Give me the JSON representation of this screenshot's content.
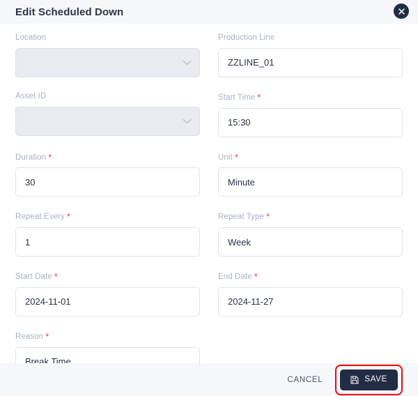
{
  "dialog": {
    "title": "Edit Scheduled Down",
    "close_icon": "close-icon"
  },
  "colors": {
    "header_bg": "#f6f7fb",
    "footer_bg": "#f6f7fb",
    "accent_dark": "#232c45",
    "required_asterisk": "#f0395a",
    "label": "#a9b1c4",
    "border": "#dfe3ec",
    "disabled_bg": "#e9ebf0",
    "highlight_outline": "#ff0000"
  },
  "form": {
    "fields": [
      {
        "name": "location",
        "label": "Location",
        "required": false,
        "type": "select",
        "value": "",
        "placeholder": "",
        "disabled": true,
        "icon": "chevron-down-icon"
      },
      {
        "name": "production-line",
        "label": "Production Line",
        "required": false,
        "type": "text",
        "value": "ZZLINE_01",
        "placeholder": "",
        "disabled": false
      },
      {
        "name": "asset-id",
        "label": "Asset ID",
        "required": false,
        "type": "select",
        "value": "",
        "placeholder": "",
        "disabled": true,
        "icon": "chevron-down-icon"
      },
      {
        "name": "start-time",
        "label": "Start Time",
        "required": true,
        "type": "text",
        "value": "15:30",
        "placeholder": "",
        "disabled": false
      },
      {
        "name": "duration",
        "label": "Duration",
        "required": true,
        "type": "text",
        "value": "30",
        "placeholder": "",
        "disabled": false
      },
      {
        "name": "unit",
        "label": "Unit",
        "required": true,
        "type": "text",
        "value": "Minute",
        "placeholder": "",
        "disabled": false
      },
      {
        "name": "repeat-every",
        "label": "Repeat Every",
        "required": true,
        "type": "text",
        "value": "1",
        "placeholder": "",
        "disabled": false
      },
      {
        "name": "repeat-type",
        "label": "Repeat Type",
        "required": true,
        "type": "text",
        "value": "Week",
        "placeholder": "",
        "disabled": false
      },
      {
        "name": "start-date",
        "label": "Start Date",
        "required": true,
        "type": "text",
        "value": "2024-11-01",
        "placeholder": "",
        "disabled": false
      },
      {
        "name": "end-date",
        "label": "End Date",
        "required": true,
        "type": "text",
        "value": "2024-11-27",
        "placeholder": "",
        "disabled": false
      },
      {
        "name": "reason",
        "label": "Reason",
        "required": true,
        "type": "text",
        "value": "Break Time",
        "placeholder": "",
        "disabled": false
      }
    ],
    "required_marker": "*"
  },
  "footer": {
    "cancel_label": "CANCEL",
    "save_label": "SAVE",
    "save_icon": "save-floppy-icon"
  }
}
